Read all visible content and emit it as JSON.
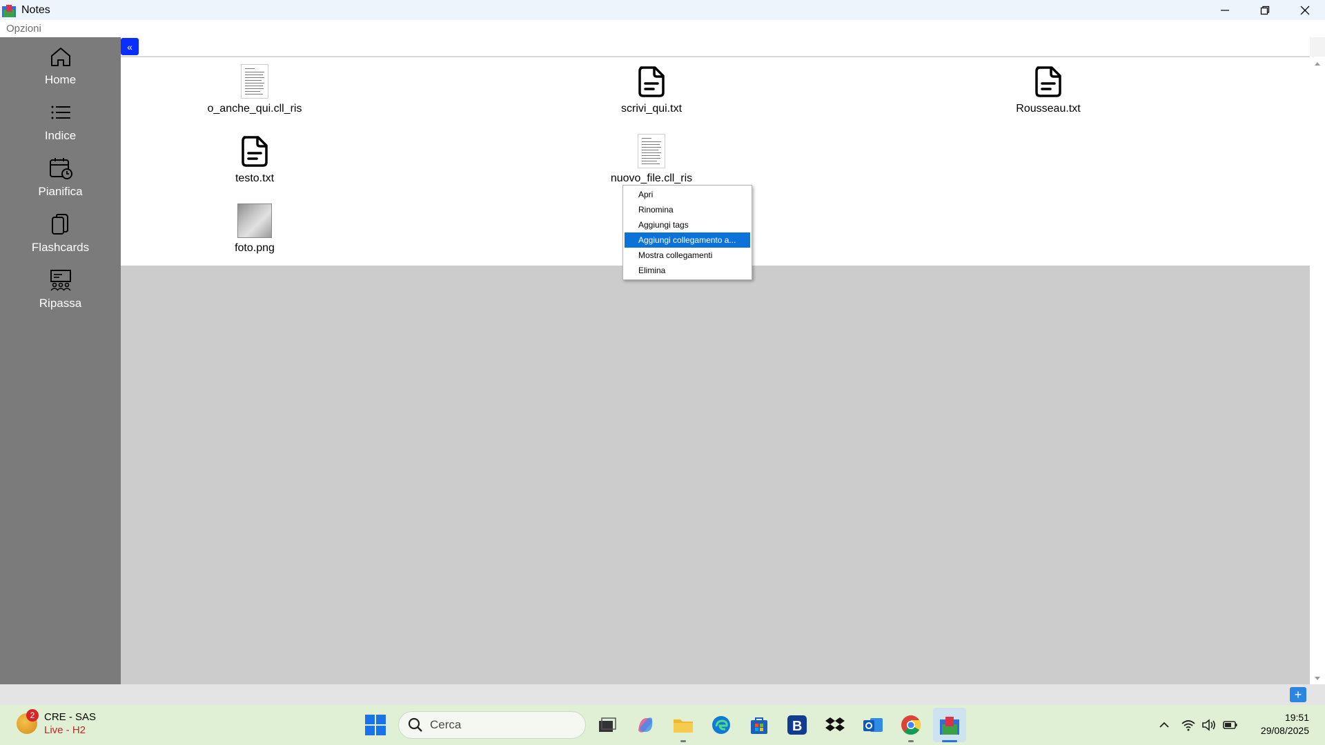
{
  "window": {
    "title": "Notes"
  },
  "menu": {
    "options_label": "Opzioni"
  },
  "sidebar": {
    "items": [
      {
        "label": "Home",
        "icon": "home-icon"
      },
      {
        "label": "Indice",
        "icon": "list-icon"
      },
      {
        "label": "Pianifica",
        "icon": "calendar-clock-icon"
      },
      {
        "label": "Flashcards",
        "icon": "cards-icon"
      },
      {
        "label": "Ripassa",
        "icon": "review-icon"
      }
    ]
  },
  "main": {
    "collapse_label": "«",
    "files": [
      {
        "name": "o_anche_qui.cll_ris",
        "type": "document-thumbnail"
      },
      {
        "name": "scrivi_qui.txt",
        "type": "text-file-icon"
      },
      {
        "name": "Rousseau.txt",
        "type": "text-file-icon"
      },
      {
        "name": "testo.txt",
        "type": "text-file-icon"
      },
      {
        "name": "nuovo_file.cll_ris",
        "type": "document-thumbnail"
      },
      {
        "name": "foto.png",
        "type": "image-thumbnail"
      }
    ],
    "add_label": "+"
  },
  "context_menu": {
    "items": [
      "Apri",
      "Rinomina",
      "Aggiungi tags",
      "Aggiungi collegamento a...",
      "Mostra collegamenti",
      "Elimina"
    ],
    "highlighted": "Aggiungi collegamento a..."
  },
  "taskbar": {
    "weather": {
      "badge": "2",
      "line1": "CRE - SAS",
      "line2": "Live - H2"
    },
    "search_placeholder": "Cerca",
    "time": "19:51",
    "date": "29/08/2025"
  },
  "colors": {
    "accent": "#0b72da",
    "sidebar": "#7b7b7b",
    "collapse": "#0a2eff"
  }
}
